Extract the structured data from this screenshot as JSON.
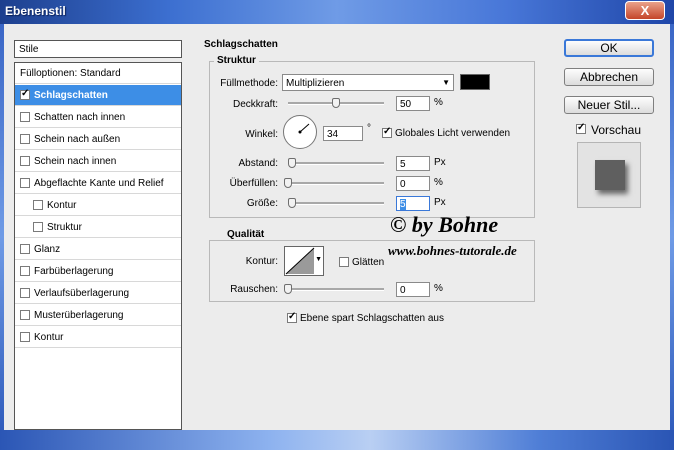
{
  "window": {
    "title": "Ebenenstil",
    "close_glyph": "X"
  },
  "stile_header": "Stile",
  "style_items": [
    {
      "label": "Fülloptionen: Standard",
      "checkbox": false,
      "checked": false,
      "selected": false
    },
    {
      "label": "Schlagschatten",
      "checkbox": true,
      "checked": true,
      "selected": true
    },
    {
      "label": "Schatten nach innen",
      "checkbox": true,
      "checked": false,
      "selected": false
    },
    {
      "label": "Schein nach außen",
      "checkbox": true,
      "checked": false,
      "selected": false
    },
    {
      "label": "Schein nach innen",
      "checkbox": true,
      "checked": false,
      "selected": false
    },
    {
      "label": "Abgeflachte Kante und Relief",
      "checkbox": true,
      "checked": false,
      "selected": false
    },
    {
      "label": "Kontur",
      "checkbox": true,
      "checked": false,
      "selected": false,
      "indent": true
    },
    {
      "label": "Struktur",
      "checkbox": true,
      "checked": false,
      "selected": false,
      "indent": true
    },
    {
      "label": "Glanz",
      "checkbox": true,
      "checked": false,
      "selected": false
    },
    {
      "label": "Farbüberlagerung",
      "checkbox": true,
      "checked": false,
      "selected": false
    },
    {
      "label": "Verlaufsüberlagerung",
      "checkbox": true,
      "checked": false,
      "selected": false
    },
    {
      "label": "Musterüberlagerung",
      "checkbox": true,
      "checked": false,
      "selected": false
    },
    {
      "label": "Kontur",
      "checkbox": true,
      "checked": false,
      "selected": false
    }
  ],
  "panel": {
    "title": "Schlagschatten",
    "struktur": {
      "title": "Struktur",
      "blend_label": "Füllmethode:",
      "blend_value": "Multiplizieren",
      "color_swatch": "#000000",
      "opacity_label": "Deckkraft:",
      "opacity_value": "50",
      "opacity_unit": "%",
      "opacity_fraction": 0.5,
      "angle_label": "Winkel:",
      "angle_value": "34",
      "angle_unit": "°",
      "global_light_label": "Globales Licht verwenden",
      "global_light_checked": true,
      "distance_label": "Abstand:",
      "distance_value": "5",
      "distance_unit": "Px",
      "spread_label": "Überfüllen:",
      "spread_value": "0",
      "spread_unit": "%",
      "size_label": "Größe:",
      "size_value": "5",
      "size_unit": "Px"
    },
    "qualitaet": {
      "title": "Qualität",
      "contour_label": "Kontur:",
      "antialias_label": "Glätten",
      "antialias_checked": false,
      "noise_label": "Rauschen:",
      "noise_value": "0",
      "noise_unit": "%"
    },
    "knockout_label": "Ebene spart Schlagschatten aus",
    "knockout_checked": true
  },
  "watermark": {
    "line1": "© by Bohne",
    "line2": "www.bohnes-tutorale.de"
  },
  "buttons": {
    "ok": "OK",
    "cancel": "Abbrechen",
    "new_style": "Neuer Stil..."
  },
  "preview": {
    "label": "Vorschau",
    "checked": true
  }
}
